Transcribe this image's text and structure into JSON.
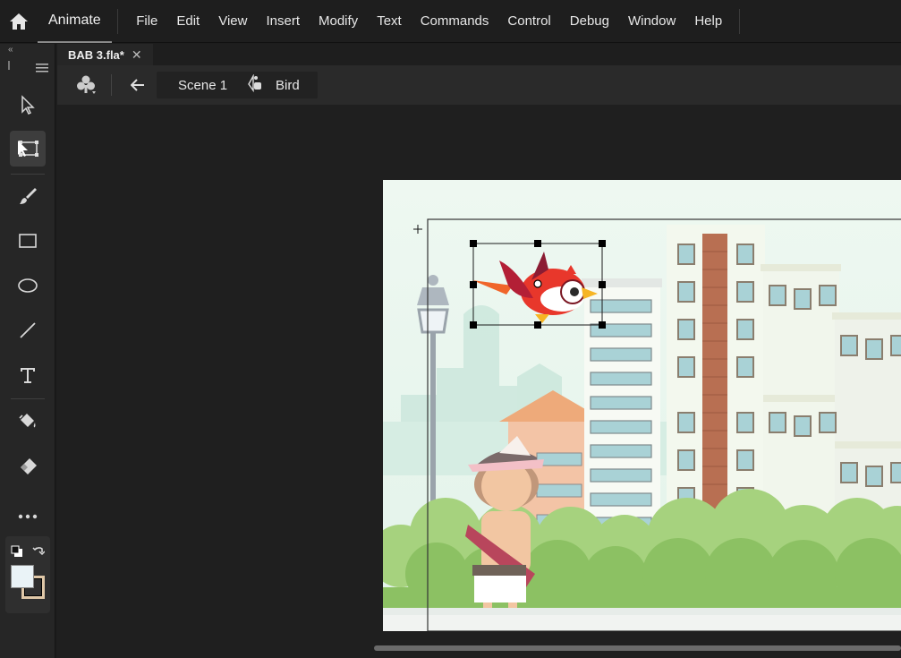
{
  "app": {
    "name": "Animate"
  },
  "menu": [
    "File",
    "Edit",
    "View",
    "Insert",
    "Modify",
    "Text",
    "Commands",
    "Control",
    "Debug",
    "Window",
    "Help"
  ],
  "document": {
    "tab_title": "BAB 3.fla*"
  },
  "breadcrumb": {
    "scene": "Scene 1",
    "symbol": "Bird"
  },
  "tools": [
    {
      "name": "selection-tool-icon"
    },
    {
      "name": "free-transform-tool-icon",
      "active": true
    },
    {
      "name": "brush-tool-icon"
    },
    {
      "name": "rectangle-tool-icon"
    },
    {
      "name": "oval-tool-icon"
    },
    {
      "name": "line-tool-icon"
    },
    {
      "name": "text-tool-icon"
    },
    {
      "name": "paint-bucket-tool-icon"
    },
    {
      "name": "eraser-tool-icon"
    },
    {
      "name": "more-tools-icon"
    }
  ],
  "colors": {
    "stroke": "#000000",
    "fill": "#eaf3f7",
    "accent": "#ffffff"
  }
}
